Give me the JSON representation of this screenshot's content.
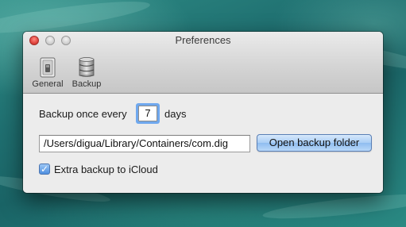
{
  "window": {
    "title": "Preferences"
  },
  "toolbar": {
    "items": [
      {
        "label": "General",
        "icon": "switch-icon"
      },
      {
        "label": "Backup",
        "icon": "database-icon"
      }
    ]
  },
  "backup": {
    "interval_prefix": "Backup once every",
    "interval_value": "7",
    "interval_unit": "days",
    "folder_path": "/Users/digua/Library/Containers/com.dig",
    "open_folder_label": "Open backup folder",
    "icloud_label": "Extra backup to iCloud",
    "icloud_checked": true,
    "checkmark": "✓"
  },
  "colors": {
    "accent": "#6fa8ee",
    "button_blue": "#a9cdf5",
    "close_red": "#e0443e"
  }
}
